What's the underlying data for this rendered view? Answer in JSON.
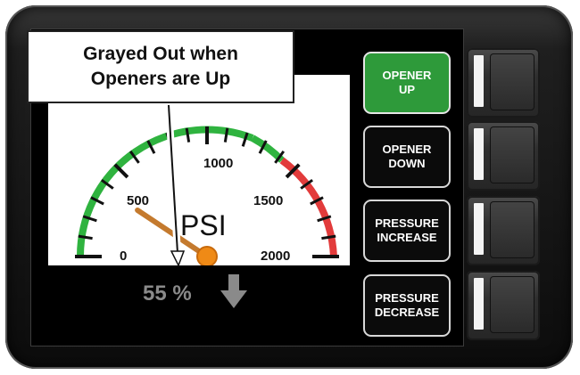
{
  "callout": {
    "line1": "Grayed Out when",
    "line2": "Openers are Up"
  },
  "gauge": {
    "unit": "PSI",
    "ticks": [
      "0",
      "500",
      "1000",
      "1500",
      "2000"
    ],
    "needle_value": 250,
    "range_max": 2000,
    "readout": "55 %",
    "readout_icon": "arrow-down-icon",
    "colors": {
      "low_band": "#2fb33f",
      "high_band": "#e23b3b",
      "needle": "#c47a2e",
      "hub": "#ef8a16"
    }
  },
  "buttons": [
    {
      "line1": "OPENER",
      "line2": "UP",
      "active": true
    },
    {
      "line1": "OPENER",
      "line2": "DOWN",
      "active": false
    },
    {
      "line1": "PRESSURE",
      "line2": "INCREASE",
      "active": false
    },
    {
      "line1": "PRESSURE",
      "line2": "DECREASE",
      "active": false
    }
  ],
  "colors": {
    "active_button": "#2e9a3a",
    "bezel": "#151515"
  }
}
